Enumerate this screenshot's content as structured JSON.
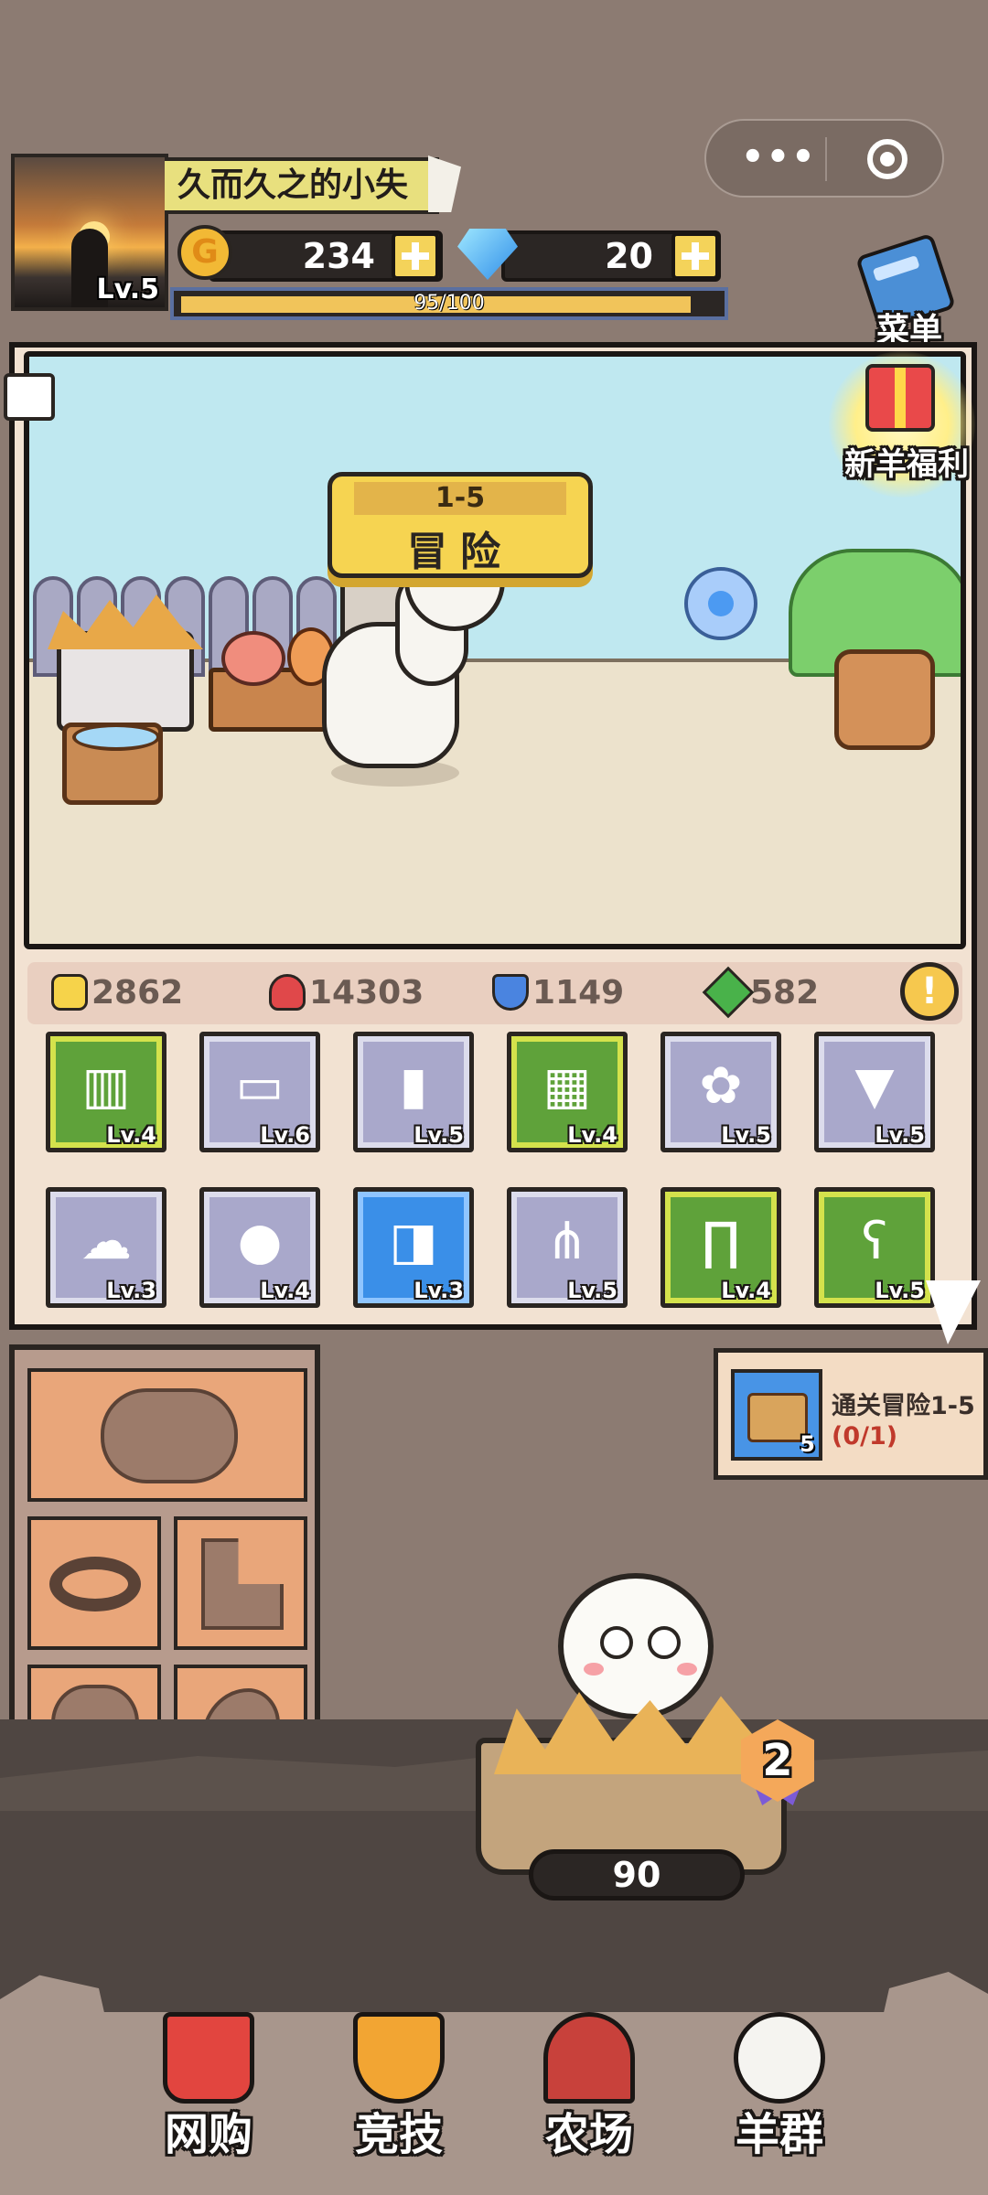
{
  "player": {
    "name": "久而久之的小失",
    "level": "Lv.5",
    "gold": "234",
    "gold_icon_text": "G",
    "gems": "20",
    "xp_text": "95/100",
    "xp_fraction": 0.95
  },
  "capsule": {
    "more_icon": "more-dots-icon",
    "close_icon": "target-circle-icon"
  },
  "menu": {
    "label": "菜单",
    "icon": "book-icon"
  },
  "gift": {
    "label": "新羊福利",
    "icon": "gift-box-icon"
  },
  "adventure": {
    "stage": "1-5",
    "label": "冒险"
  },
  "stats": {
    "attack": "2862",
    "hp": "14303",
    "defense": "1149",
    "speed": "582",
    "info_icon_text": "!"
  },
  "equipment": [
    {
      "level": "Lv.4",
      "rarity": "green",
      "icon": "bucket-icon"
    },
    {
      "level": "Lv.6",
      "rarity": "gray",
      "icon": "crate-icon"
    },
    {
      "level": "Lv.5",
      "rarity": "gray",
      "icon": "stump-icon"
    },
    {
      "level": "Lv.4",
      "rarity": "green",
      "icon": "haybale-icon"
    },
    {
      "level": "Lv.5",
      "rarity": "gray",
      "icon": "flower-icon"
    },
    {
      "level": "Lv.5",
      "rarity": "gray",
      "icon": "striped-hat-icon"
    },
    {
      "level": "Lv.3",
      "rarity": "gray",
      "icon": "bush-icon"
    },
    {
      "level": "Lv.4",
      "rarity": "gray",
      "icon": "radish-icon"
    },
    {
      "level": "Lv.3",
      "rarity": "blue",
      "icon": "sign-icon"
    },
    {
      "level": "Lv.5",
      "rarity": "gray",
      "icon": "pitchfork-icon"
    },
    {
      "level": "Lv.4",
      "rarity": "green",
      "icon": "fence-icon"
    },
    {
      "level": "Lv.5",
      "rarity": "green",
      "icon": "teddy-bear-icon"
    }
  ],
  "quest": {
    "title": "通关冒险1-5",
    "progress": "(0/1)",
    "reward_count": "5"
  },
  "nest": {
    "level": "2",
    "timer": "90"
  },
  "nav": [
    {
      "label": "网购",
      "icon": "shopping-basket-icon"
    },
    {
      "label": "竞技",
      "icon": "trophy-icon"
    },
    {
      "label": "农场",
      "icon": "barn-icon"
    },
    {
      "label": "羊群",
      "icon": "sheep-flock-icon"
    }
  ],
  "colors": {
    "accent": "#f6d451",
    "background": "#8c7b72"
  }
}
